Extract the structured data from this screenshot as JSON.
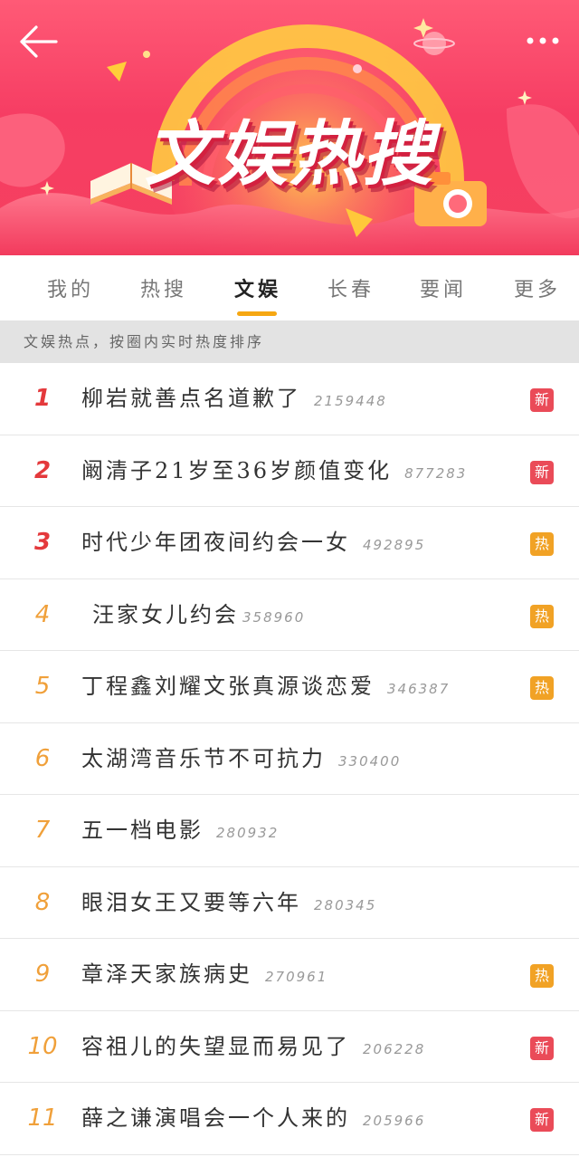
{
  "header": {
    "title": "文娱热搜",
    "back_icon": "back-arrow-icon",
    "more_icon": "more-dots-icon"
  },
  "tabs": [
    {
      "label": "我的",
      "active": false
    },
    {
      "label": "热搜",
      "active": false
    },
    {
      "label": "文娱",
      "active": true
    },
    {
      "label": "长春",
      "active": false
    },
    {
      "label": "要闻",
      "active": false
    },
    {
      "label": "更多",
      "active": false
    }
  ],
  "notice": "文娱热点，按圈内实时热度排序",
  "colors": {
    "banner": "#f63d63",
    "tab_underline": "#f6a712",
    "rank_top": "#e4393c",
    "rank_other": "#f0a03a",
    "badge_new": "#ea4b58",
    "badge_hot": "#f1a225"
  },
  "items": [
    {
      "rank": "1",
      "title": "柳岩就善点名道歉了",
      "count": "2159448",
      "badge": "新",
      "badge_type": "new"
    },
    {
      "rank": "2",
      "title": "阚清子21岁至36岁颜值变化",
      "count": "877283",
      "badge": "新",
      "badge_type": "new"
    },
    {
      "rank": "3",
      "title": "时代少年团夜间约会一女",
      "count": "492895",
      "badge": "热",
      "badge_type": "hot"
    },
    {
      "rank": "4",
      "title": "汪家女儿约会",
      "count": "358960",
      "badge": "热",
      "badge_type": "hot"
    },
    {
      "rank": "5",
      "title": "丁程鑫刘耀文张真源谈恋爱",
      "count": "346387",
      "badge": "热",
      "badge_type": "hot"
    },
    {
      "rank": "6",
      "title": "太湖湾音乐节不可抗力",
      "count": "330400",
      "badge": "",
      "badge_type": ""
    },
    {
      "rank": "7",
      "title": "五一档电影",
      "count": "280932",
      "badge": "",
      "badge_type": ""
    },
    {
      "rank": "8",
      "title": "眼泪女王又要等六年",
      "count": "280345",
      "badge": "",
      "badge_type": ""
    },
    {
      "rank": "9",
      "title": "章泽天家族病史",
      "count": "270961",
      "badge": "热",
      "badge_type": "hot"
    },
    {
      "rank": "10",
      "title": "容祖儿的失望显而易见了",
      "count": "206228",
      "badge": "新",
      "badge_type": "new"
    },
    {
      "rank": "11",
      "title": "薛之谦演唱会一个人来的",
      "count": "205966",
      "badge": "新",
      "badge_type": "new"
    }
  ]
}
